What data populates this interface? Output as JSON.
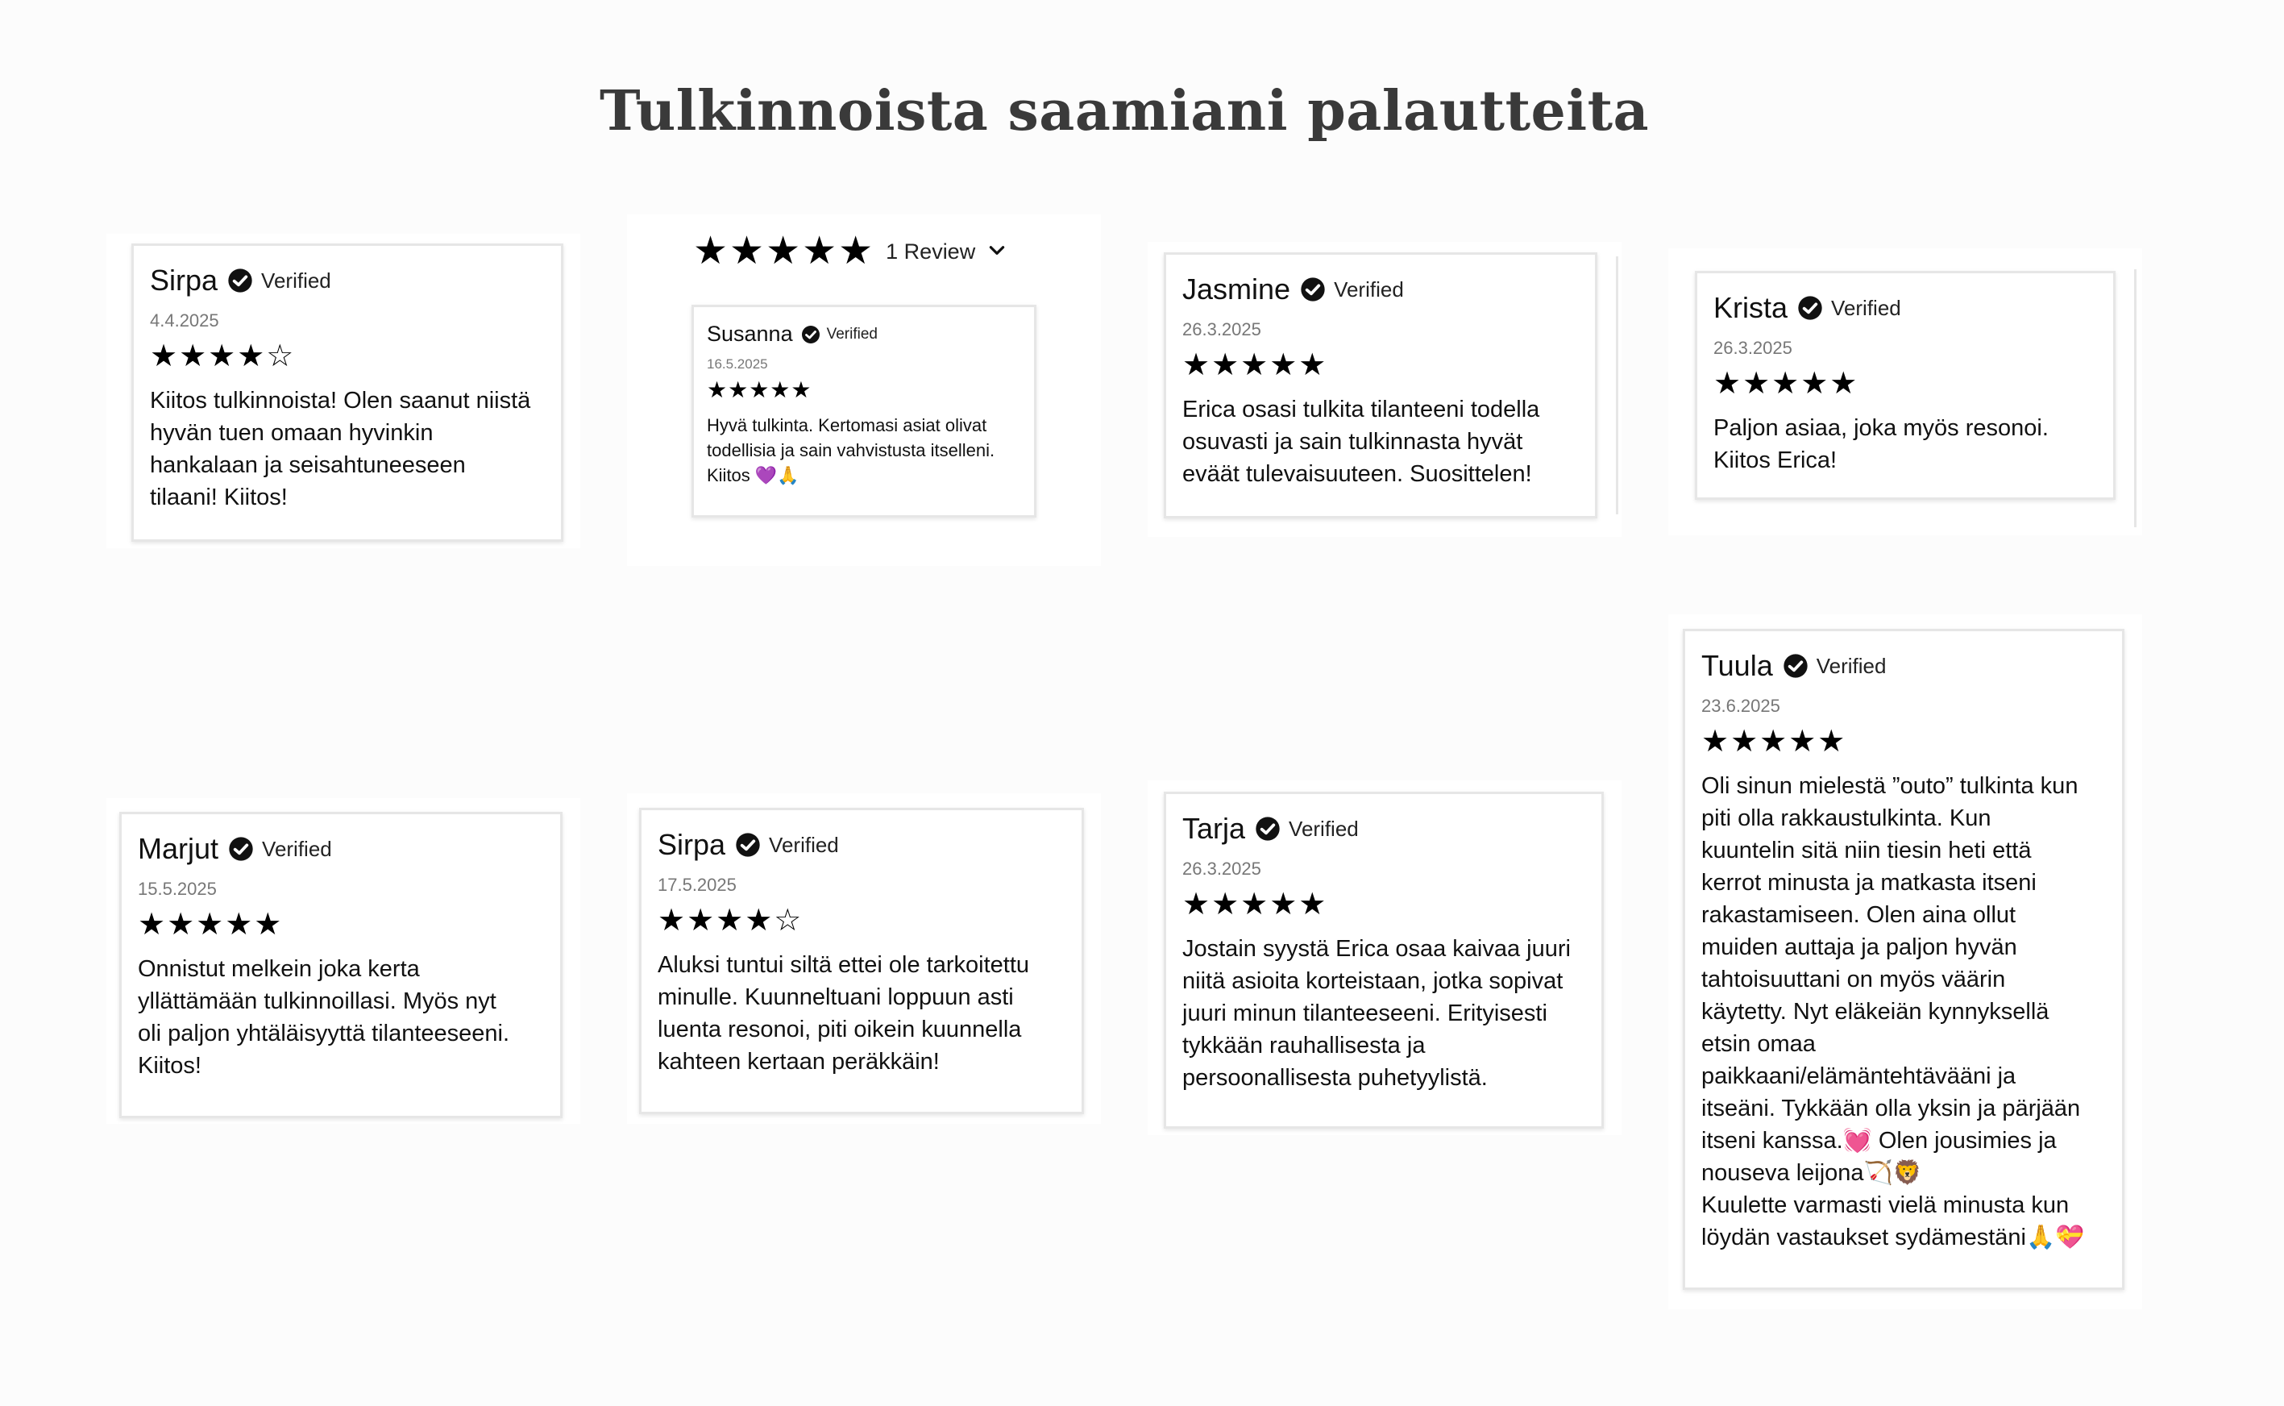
{
  "page_title": "Tulkinnoista saamiani palautteita",
  "verified_label": "Verified",
  "widget_summary": {
    "stars": "★★★★★",
    "rating": 5,
    "count_label": "1 Review"
  },
  "reviews": [
    {
      "name": "Sirpa",
      "date": "4.4.2025",
      "rating": 4,
      "stars": "★★★★☆",
      "text": "Kiitos tulkinnoista! Olen saanut niistä\nhyvän tuen omaan hyvinkin\nhankalaan ja seisahtuneeseen\ntilaani! Kiitos!"
    },
    {
      "name": "Susanna",
      "date": "16.5.2025",
      "rating": 5,
      "stars": "★★★★★",
      "text": "Hyvä tulkinta. Kertomasi asiat olivat\ntodellisia ja sain vahvistusta itselleni.\nKiitos 💜🙏"
    },
    {
      "name": "Jasmine",
      "date": "26.3.2025",
      "rating": 5,
      "stars": "★★★★★",
      "text": "Erica osasi tulkita tilanteeni todella\nosuvasti ja sain tulkinnasta hyvät\neväät tulevaisuuteen. Suosittelen!"
    },
    {
      "name": "Krista",
      "date": "26.3.2025",
      "rating": 5,
      "stars": "★★★★★",
      "text": "Paljon asiaa, joka myös resonoi.\nKiitos Erica!"
    },
    {
      "name": "Marjut",
      "date": "15.5.2025",
      "rating": 5,
      "stars": "★★★★★",
      "text": "Onnistut melkein joka kerta\nyllättämään tulkinnoillasi. Myös nyt\noli paljon yhtäläisyyttä tilanteeseeni.\nKiitos!"
    },
    {
      "name": "Sirpa",
      "date": "17.5.2025",
      "rating": 4,
      "stars": "★★★★☆",
      "text": "Aluksi tuntui siltä ettei ole tarkoitettu\nminulle. Kuunneltuani loppuun asti\nluenta resonoi, piti oikein kuunnella\nkahteen kertaan peräkkäin!"
    },
    {
      "name": "Tarja",
      "date": "26.3.2025",
      "rating": 5,
      "stars": "★★★★★",
      "text": "Jostain syystä Erica osaa kaivaa juuri\nniitä asioita korteistaan, jotka sopivat\njuuri minun tilanteeseeni. Erityisesti\ntykkään rauhallisesta ja\npersoonallisesta puhetyylistä."
    },
    {
      "name": "Tuula",
      "date": "23.6.2025",
      "rating": 5,
      "stars": "★★★★★",
      "text": "Oli sinun mielestä ”outo” tulkinta kun\npiti olla rakkaustulkinta. Kun\nkuuntelin sitä niin tiesin heti että\nkerrot minusta ja matkasta itseni\nrakastamiseen. Olen aina ollut\nmuiden auttaja ja paljon hyvän\ntahtoisuuttani on myös väärin\nkäytetty. Nyt eläkeiän kynnyksellä\netsin omaa\npaikkaani/elämäntehtävääni ja\nitseäni. Tykkään olla yksin ja pärjään\nitseni kanssa.💓 Olen jousimies ja\nnouseva leijona🏹🦁\nKuulette varmasti vielä minusta kun\nlöydän vastaukset sydämestäni🙏💝"
    }
  ]
}
